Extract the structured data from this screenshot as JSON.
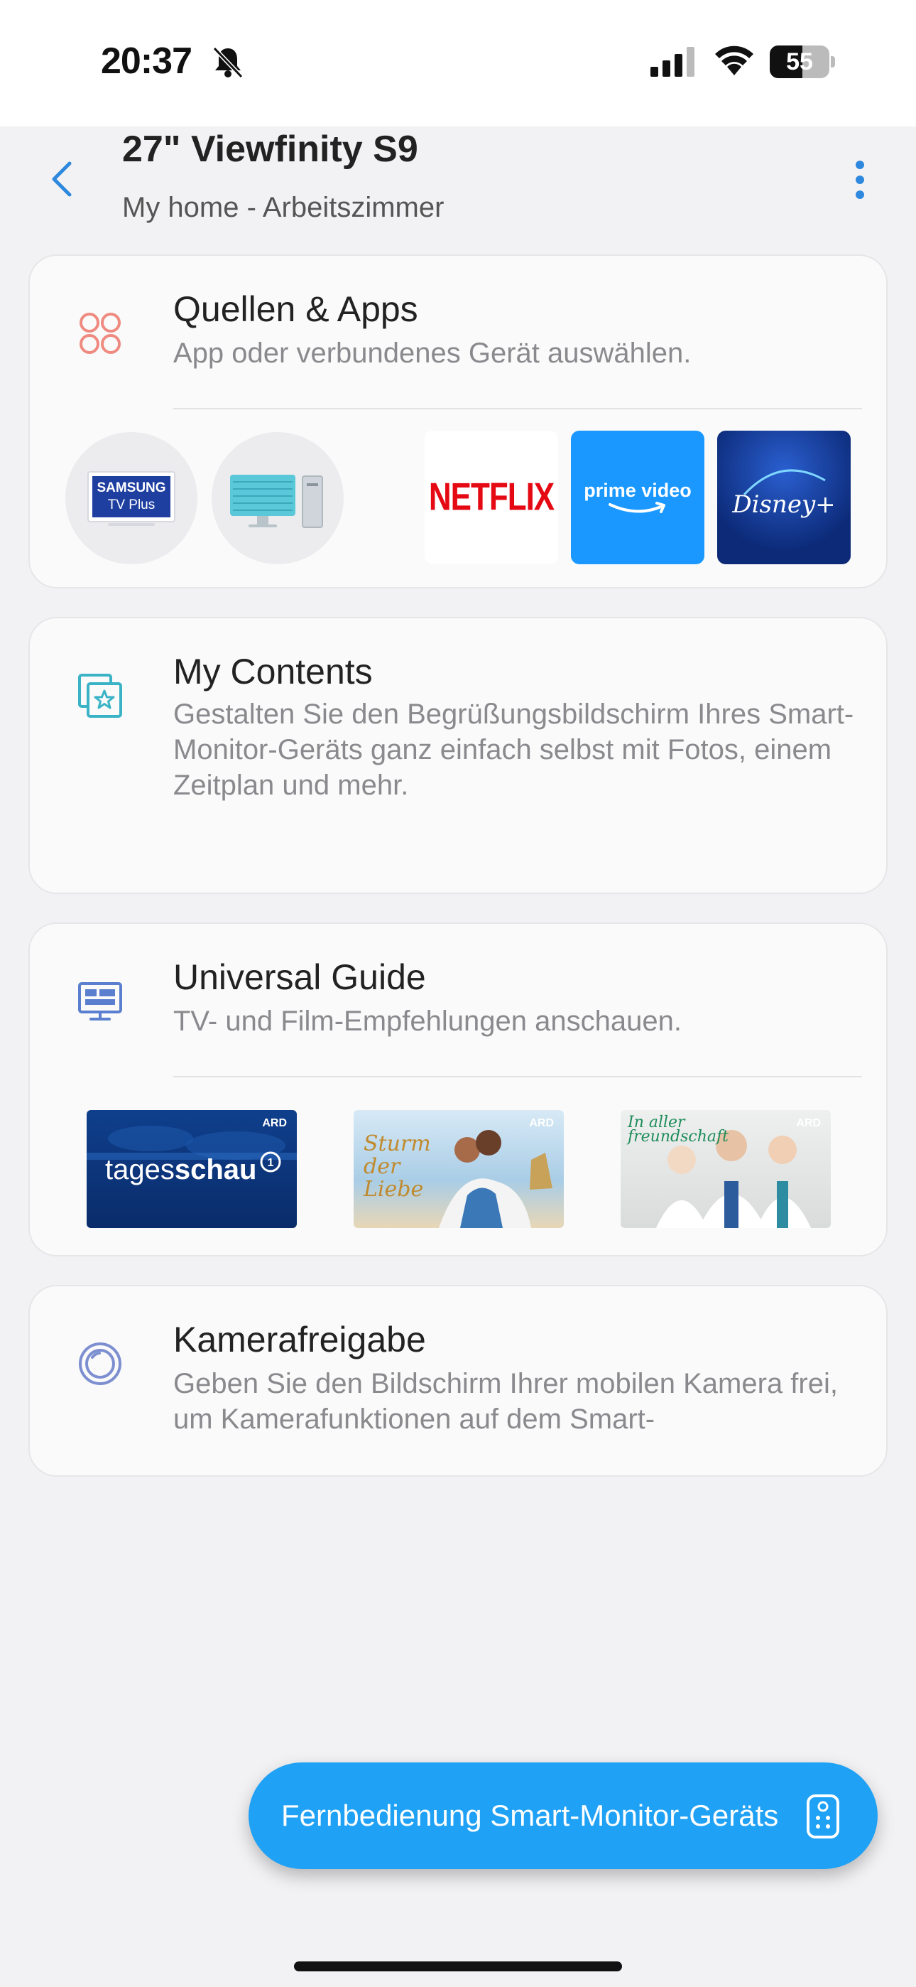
{
  "status_bar": {
    "time": "20:37",
    "battery": "55",
    "battery_level": 0.55,
    "icons": [
      "bell-slash-icon",
      "signal-icon",
      "wifi-icon",
      "battery-icon"
    ]
  },
  "header": {
    "title": "27\" Viewfinity S9",
    "location": "My home - Arbeitszimmer"
  },
  "sources_apps": {
    "title": "Quellen & Apps",
    "description": "App oder verbundenes Gerät auswählen.",
    "icon": "apps-grid-icon",
    "sources": [
      {
        "name": "samsung-tv-plus",
        "line1": "SAMSUNG",
        "line2": "TV Plus"
      },
      {
        "name": "pc-source"
      }
    ],
    "apps": [
      {
        "name": "netflix",
        "label": "NETFLIX",
        "bg": "#ffffff",
        "color": "#e50914"
      },
      {
        "name": "prime-video",
        "label": "prime video",
        "bg": "#1a98ff",
        "color": "#ffffff"
      },
      {
        "name": "disney-plus",
        "label": "Disney+",
        "bg": "#0c2a78",
        "color": "#ffffff"
      }
    ]
  },
  "my_contents": {
    "title": "My Contents",
    "description": "Gestalten Sie den Begrüßungsbildschirm Ihres Smart-Monitor-Geräts ganz einfach selbst mit Fotos, einem Zeitplan und mehr.",
    "icon": "star-frame-icon"
  },
  "universal_guide": {
    "title": "Universal Guide",
    "description": "TV- und Film-Empfehlungen anschauen.",
    "icon": "guide-screen-icon",
    "items": [
      {
        "name": "tagesschau",
        "label_a": "tages",
        "label_b": "schau",
        "badge": "ARD"
      },
      {
        "name": "sturm-der-liebe",
        "label": "Sturm der Liebe",
        "badge": "ARD"
      },
      {
        "name": "in-aller-freundschaft",
        "label": "In aller freundschaft",
        "badge": "ARD"
      }
    ]
  },
  "camera_share": {
    "title": "Kamerafreigabe",
    "description": "Geben Sie den Bildschirm Ihrer mobilen Kamera frei, um Kamerafunktionen auf dem Smart-",
    "icon": "camera-lens-icon"
  },
  "remote_button": {
    "label": "Fernbedienung Smart-Monitor-Geräts",
    "icon": "remote-control-icon"
  },
  "colors": {
    "accent": "#1fa1f5",
    "link_blue": "#2e88dd",
    "apps_icon": "#ef8a80",
    "contents_icon": "#3ab3c6",
    "guide_icon": "#5b7fcf",
    "camera_icon": "#7d8fd0"
  }
}
